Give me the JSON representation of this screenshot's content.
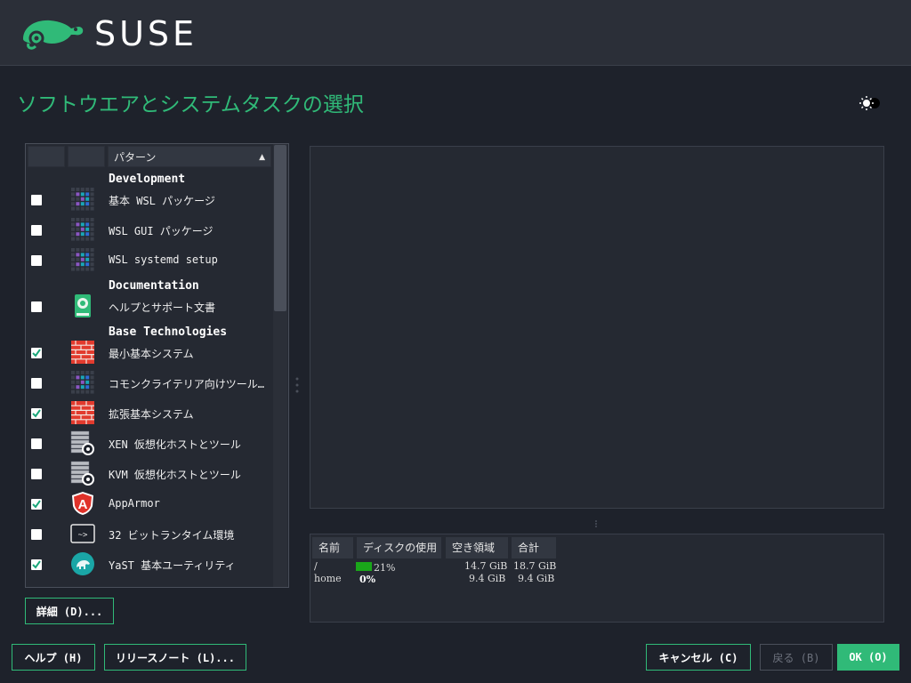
{
  "header": {
    "brand": "SUSE"
  },
  "page": {
    "title": "ソフトウエアとシステムタスクの選択"
  },
  "pattern_table": {
    "columns": [
      "",
      "",
      "パターン"
    ],
    "groups": [
      {
        "title": "Development",
        "items": [
          {
            "label": "基本 WSL パッケージ",
            "checked": false,
            "icon": "pattern-grid-icon"
          },
          {
            "label": "WSL GUI パッケージ",
            "checked": false,
            "icon": "pattern-grid-icon"
          },
          {
            "label": "WSL systemd setup",
            "checked": false,
            "icon": "pattern-grid-icon"
          }
        ]
      },
      {
        "title": "Documentation",
        "items": [
          {
            "label": "ヘルプとサポート文書",
            "checked": false,
            "icon": "help-book-icon"
          }
        ]
      },
      {
        "title": "Base Technologies",
        "items": [
          {
            "label": "最小基本システム",
            "checked": true,
            "icon": "brick-wall-icon"
          },
          {
            "label": "コモンクライテリア向けツール…",
            "checked": false,
            "icon": "pattern-grid-icon"
          },
          {
            "label": "拡張基本システム",
            "checked": true,
            "icon": "brick-wall-icon"
          },
          {
            "label": "XEN 仮想化ホストとツール",
            "checked": false,
            "icon": "server-gear-icon"
          },
          {
            "label": "KVM 仮想化ホストとツール",
            "checked": false,
            "icon": "server-gear-icon"
          },
          {
            "label": "AppArmor",
            "checked": true,
            "icon": "apparmor-shield-icon"
          },
          {
            "label": "32 ビットランタイム環境",
            "checked": false,
            "icon": "terminal-icon"
          },
          {
            "label": "YaST 基本ユーティリティ",
            "checked": true,
            "icon": "yast-chameleon-icon"
          }
        ]
      }
    ]
  },
  "disk_usage": {
    "columns": [
      "名前",
      "ディスクの使用",
      "空き領域",
      "合計"
    ],
    "rows": [
      {
        "name": "/",
        "usage": "21%",
        "usage_fraction": 0.21,
        "free": "14.7 GiB",
        "total": "18.7 GiB"
      },
      {
        "name": "home",
        "usage": "0%",
        "usage_fraction": 0.0,
        "free": "9.4 GiB",
        "total": "9.4 GiB"
      }
    ]
  },
  "buttons": {
    "details": "詳細 (D)...",
    "help": "ヘルプ (H)",
    "release_notes": "リリースノート (L)...",
    "cancel": "キャンセル (C)",
    "back": "戻る (B)",
    "ok": "OK (O)"
  },
  "colors": {
    "accent": "#30ba78",
    "background": "#1e222b",
    "header": "#2b2f38"
  }
}
